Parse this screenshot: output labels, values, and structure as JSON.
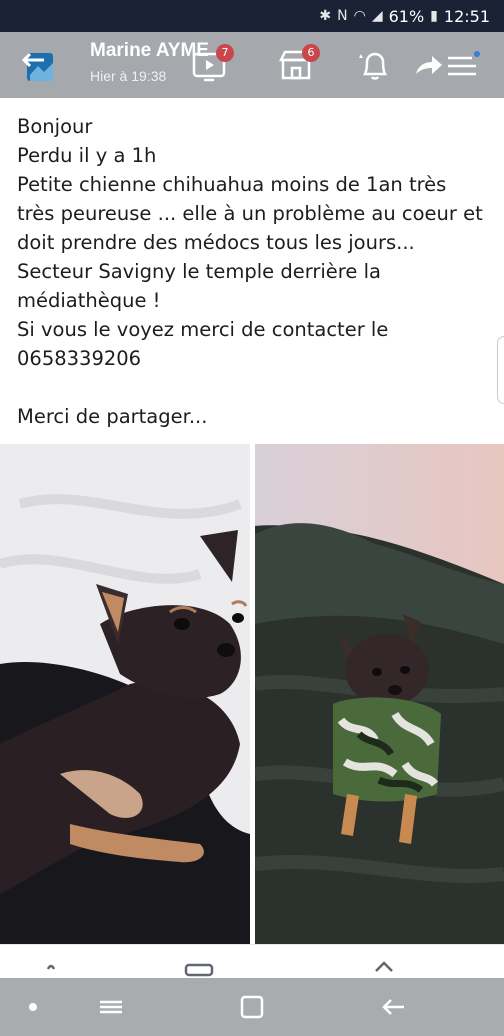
{
  "status_bar": {
    "battery": "61%",
    "time": "12:51",
    "icons": [
      "bluetooth-icon",
      "nfc-icon",
      "wifi-icon",
      "signal-icon",
      "battery-icon"
    ]
  },
  "header": {
    "author": "Marine AYME",
    "timestamp": "Hier à 19:38",
    "video_badge": "7",
    "marketplace_badge": "6"
  },
  "post": {
    "lines": [
      "Bonjour",
      "Perdu il y a 1h",
      "Petite chienne chihuahua moins de 1an très",
      "très peureuse ... elle à un problème au coeur et",
      "doit prendre des médocs tous les jours...",
      "Secteur Savigny le temple derrière la",
      "médiathèque !",
      "Si vous le voyez merci de contacter le",
      "0658339206",
      "",
      "Merci de partager..."
    ]
  },
  "photos": [
    {
      "subject": "chihuahua-lying-on-white-blanket"
    },
    {
      "subject": "chihuahua-in-camouflage-coat"
    }
  ],
  "colors": {
    "status_bar": "#1c2236",
    "top_bar": "#a5a8ad",
    "badge": "#c9464b",
    "nav_bar": "#a9abaf"
  }
}
